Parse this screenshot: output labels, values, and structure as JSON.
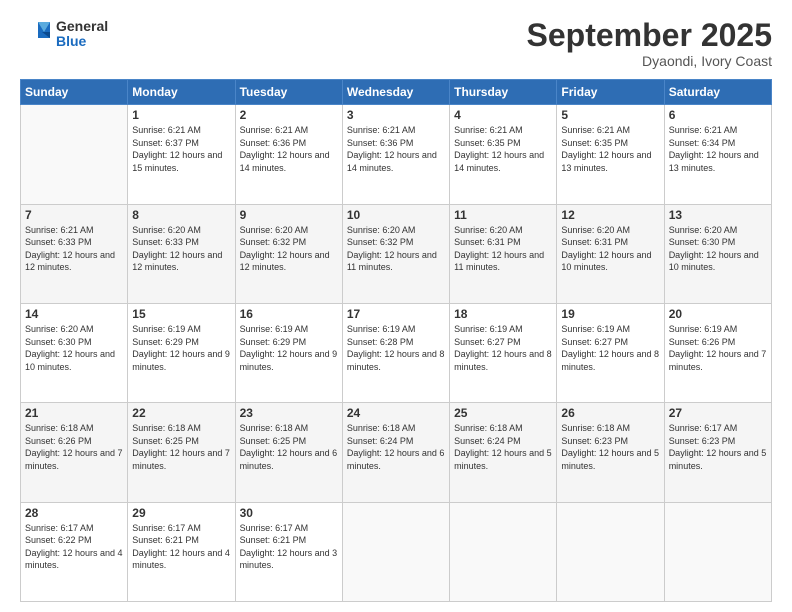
{
  "header": {
    "logo_general": "General",
    "logo_blue": "Blue",
    "month_title": "September 2025",
    "location": "Dyaondi, Ivory Coast"
  },
  "days_of_week": [
    "Sunday",
    "Monday",
    "Tuesday",
    "Wednesday",
    "Thursday",
    "Friday",
    "Saturday"
  ],
  "weeks": [
    [
      {
        "num": "",
        "info": ""
      },
      {
        "num": "1",
        "info": "Sunrise: 6:21 AM\nSunset: 6:37 PM\nDaylight: 12 hours\nand 15 minutes."
      },
      {
        "num": "2",
        "info": "Sunrise: 6:21 AM\nSunset: 6:36 PM\nDaylight: 12 hours\nand 14 minutes."
      },
      {
        "num": "3",
        "info": "Sunrise: 6:21 AM\nSunset: 6:36 PM\nDaylight: 12 hours\nand 14 minutes."
      },
      {
        "num": "4",
        "info": "Sunrise: 6:21 AM\nSunset: 6:35 PM\nDaylight: 12 hours\nand 14 minutes."
      },
      {
        "num": "5",
        "info": "Sunrise: 6:21 AM\nSunset: 6:35 PM\nDaylight: 12 hours\nand 13 minutes."
      },
      {
        "num": "6",
        "info": "Sunrise: 6:21 AM\nSunset: 6:34 PM\nDaylight: 12 hours\nand 13 minutes."
      }
    ],
    [
      {
        "num": "7",
        "info": "Sunrise: 6:21 AM\nSunset: 6:33 PM\nDaylight: 12 hours\nand 12 minutes."
      },
      {
        "num": "8",
        "info": "Sunrise: 6:20 AM\nSunset: 6:33 PM\nDaylight: 12 hours\nand 12 minutes."
      },
      {
        "num": "9",
        "info": "Sunrise: 6:20 AM\nSunset: 6:32 PM\nDaylight: 12 hours\nand 12 minutes."
      },
      {
        "num": "10",
        "info": "Sunrise: 6:20 AM\nSunset: 6:32 PM\nDaylight: 12 hours\nand 11 minutes."
      },
      {
        "num": "11",
        "info": "Sunrise: 6:20 AM\nSunset: 6:31 PM\nDaylight: 12 hours\nand 11 minutes."
      },
      {
        "num": "12",
        "info": "Sunrise: 6:20 AM\nSunset: 6:31 PM\nDaylight: 12 hours\nand 10 minutes."
      },
      {
        "num": "13",
        "info": "Sunrise: 6:20 AM\nSunset: 6:30 PM\nDaylight: 12 hours\nand 10 minutes."
      }
    ],
    [
      {
        "num": "14",
        "info": "Sunrise: 6:20 AM\nSunset: 6:30 PM\nDaylight: 12 hours\nand 10 minutes."
      },
      {
        "num": "15",
        "info": "Sunrise: 6:19 AM\nSunset: 6:29 PM\nDaylight: 12 hours\nand 9 minutes."
      },
      {
        "num": "16",
        "info": "Sunrise: 6:19 AM\nSunset: 6:29 PM\nDaylight: 12 hours\nand 9 minutes."
      },
      {
        "num": "17",
        "info": "Sunrise: 6:19 AM\nSunset: 6:28 PM\nDaylight: 12 hours\nand 8 minutes."
      },
      {
        "num": "18",
        "info": "Sunrise: 6:19 AM\nSunset: 6:27 PM\nDaylight: 12 hours\nand 8 minutes."
      },
      {
        "num": "19",
        "info": "Sunrise: 6:19 AM\nSunset: 6:27 PM\nDaylight: 12 hours\nand 8 minutes."
      },
      {
        "num": "20",
        "info": "Sunrise: 6:19 AM\nSunset: 6:26 PM\nDaylight: 12 hours\nand 7 minutes."
      }
    ],
    [
      {
        "num": "21",
        "info": "Sunrise: 6:18 AM\nSunset: 6:26 PM\nDaylight: 12 hours\nand 7 minutes."
      },
      {
        "num": "22",
        "info": "Sunrise: 6:18 AM\nSunset: 6:25 PM\nDaylight: 12 hours\nand 7 minutes."
      },
      {
        "num": "23",
        "info": "Sunrise: 6:18 AM\nSunset: 6:25 PM\nDaylight: 12 hours\nand 6 minutes."
      },
      {
        "num": "24",
        "info": "Sunrise: 6:18 AM\nSunset: 6:24 PM\nDaylight: 12 hours\nand 6 minutes."
      },
      {
        "num": "25",
        "info": "Sunrise: 6:18 AM\nSunset: 6:24 PM\nDaylight: 12 hours\nand 5 minutes."
      },
      {
        "num": "26",
        "info": "Sunrise: 6:18 AM\nSunset: 6:23 PM\nDaylight: 12 hours\nand 5 minutes."
      },
      {
        "num": "27",
        "info": "Sunrise: 6:17 AM\nSunset: 6:23 PM\nDaylight: 12 hours\nand 5 minutes."
      }
    ],
    [
      {
        "num": "28",
        "info": "Sunrise: 6:17 AM\nSunset: 6:22 PM\nDaylight: 12 hours\nand 4 minutes."
      },
      {
        "num": "29",
        "info": "Sunrise: 6:17 AM\nSunset: 6:21 PM\nDaylight: 12 hours\nand 4 minutes."
      },
      {
        "num": "30",
        "info": "Sunrise: 6:17 AM\nSunset: 6:21 PM\nDaylight: 12 hours\nand 3 minutes."
      },
      {
        "num": "",
        "info": ""
      },
      {
        "num": "",
        "info": ""
      },
      {
        "num": "",
        "info": ""
      },
      {
        "num": "",
        "info": ""
      }
    ]
  ]
}
